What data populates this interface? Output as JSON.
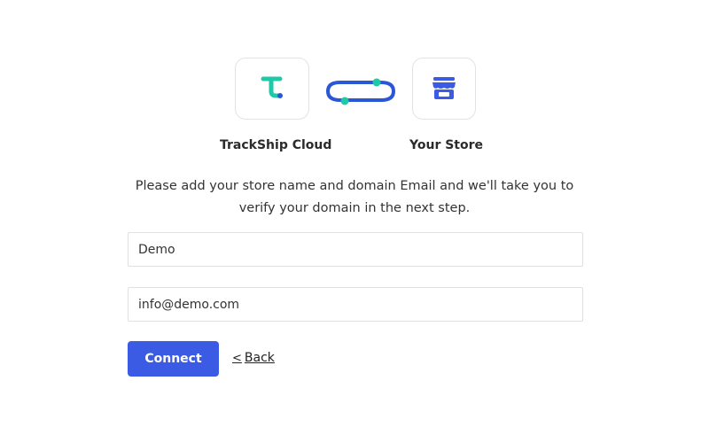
{
  "integration": {
    "left_logo": {
      "icon": "trackship-logo-icon",
      "label": "TrackShip Cloud",
      "color": "#1fc9a8",
      "accent": "#2a57d6"
    },
    "connector": {
      "icon": "link-connector-icon",
      "color": "#2a57d6",
      "dot_color": "#1fc9a8"
    },
    "right_logo": {
      "icon": "store-icon",
      "label": "Your Store",
      "color": "#3b5be4"
    }
  },
  "description": "Please add your store name and domain Email and we'll take you to verify your domain in the next step.",
  "form": {
    "store_name": {
      "value": "Demo",
      "placeholder": ""
    },
    "email": {
      "value": "info@demo.com",
      "placeholder": ""
    }
  },
  "actions": {
    "connect_label": "Connect",
    "back_label": "Back",
    "back_icon": "<",
    "primary_color": "#3b5be4"
  }
}
